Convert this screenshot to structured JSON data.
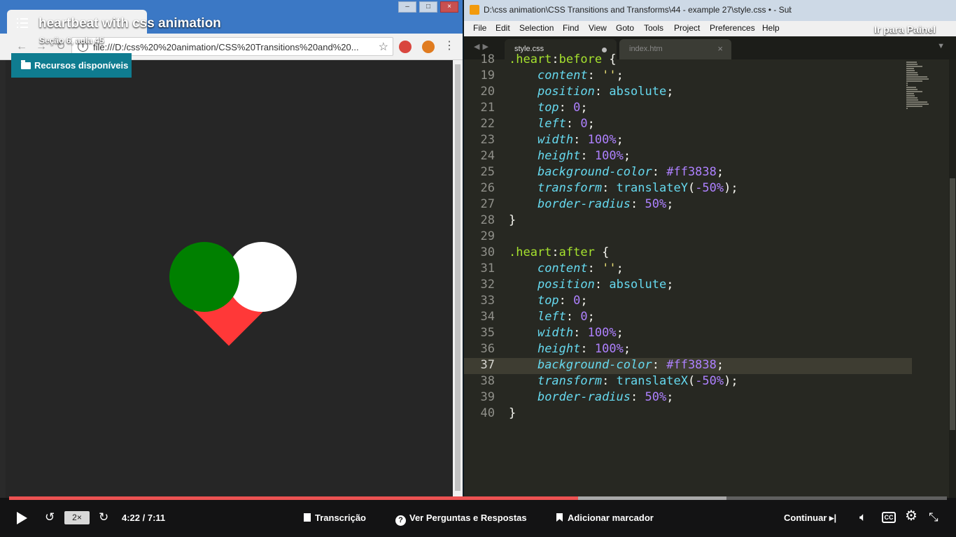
{
  "course": {
    "title": "heartbeat with css animation",
    "section": "Seção 6, aula 45",
    "resources_label": "Recursos disponíveis",
    "goto_panel_label": "Ir para Painel"
  },
  "browser": {
    "url": "file:///D:/css%20%20animation/CSS%20Transitions%20and%20...",
    "demo_colors": {
      "before": "#008000",
      "after": "#ffffff",
      "heart": "#ff3838",
      "background": "#262626"
    }
  },
  "sublime": {
    "window_title": "D:\\css  animation\\CSS Transitions and Transforms\\44 - example 27\\style.css • - Sublime Text (UNREGISTE...",
    "menu": [
      "File",
      "Edit",
      "Selection",
      "Find",
      "View",
      "Goto",
      "Tools",
      "Project",
      "Preferences",
      "Help"
    ],
    "tabs": [
      {
        "label": "style.css",
        "active": true,
        "modified": true
      },
      {
        "label": "index.htm",
        "active": false,
        "modified": false
      }
    ],
    "active_line": "37",
    "lines": [
      {
        "n": "18",
        "text": ".heart:before {"
      },
      {
        "n": "19",
        "text": "    content: '';"
      },
      {
        "n": "20",
        "text": "    position: absolute;"
      },
      {
        "n": "21",
        "text": "    top: 0;"
      },
      {
        "n": "22",
        "text": "    left: 0;"
      },
      {
        "n": "23",
        "text": "    width: 100%;"
      },
      {
        "n": "24",
        "text": "    height: 100%;"
      },
      {
        "n": "25",
        "text": "    background-color: #ff3838;"
      },
      {
        "n": "26",
        "text": "    transform: translateY(-50%);"
      },
      {
        "n": "27",
        "text": "    border-radius: 50%;"
      },
      {
        "n": "28",
        "text": "}"
      },
      {
        "n": "29",
        "text": ""
      },
      {
        "n": "30",
        "text": ".heart:after {"
      },
      {
        "n": "31",
        "text": "    content: '';"
      },
      {
        "n": "32",
        "text": "    position: absolute;"
      },
      {
        "n": "33",
        "text": "    top: 0;"
      },
      {
        "n": "34",
        "text": "    left: 0;"
      },
      {
        "n": "35",
        "text": "    width: 100%;"
      },
      {
        "n": "36",
        "text": "    height: 100%;"
      },
      {
        "n": "37",
        "text": "    background-color: #ff3838;"
      },
      {
        "n": "38",
        "text": "    transform: translateX(-50%);"
      },
      {
        "n": "39",
        "text": "    border-radius: 50%;"
      },
      {
        "n": "40",
        "text": "}"
      }
    ]
  },
  "player": {
    "speed": "2×",
    "time": "4:22 / 7:11",
    "progress_played": 0.607,
    "transcript_label": "Transcrição",
    "qa_label": "Ver Perguntas e Respostas",
    "bookmark_label": "Adicionar marcador",
    "continue_label": "Continuar",
    "cc_label": "CC"
  }
}
